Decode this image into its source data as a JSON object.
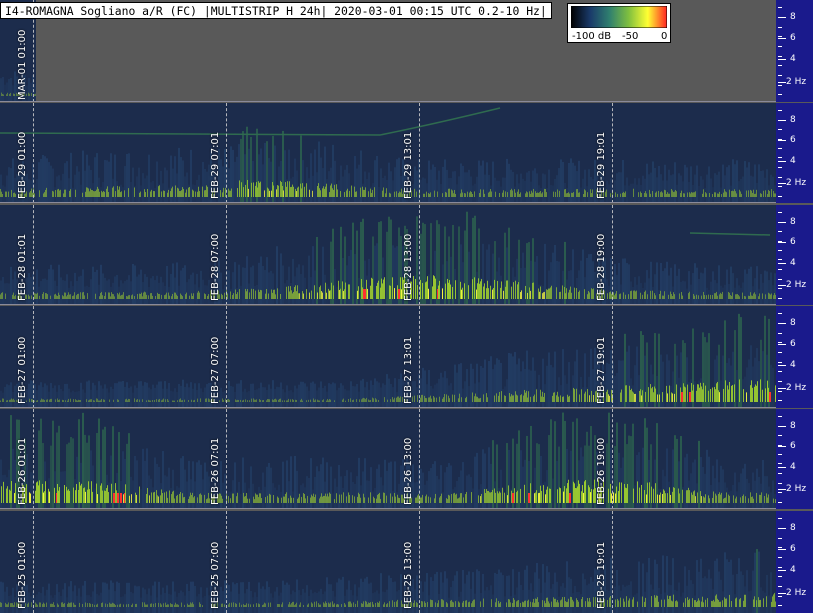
{
  "title": "I4-ROMAGNA Sogliano a/R (FC) |MULTISTRIP H 24h| 2020-03-01 00:15 UTC 0.2-10 Hz|",
  "legend": {
    "labels": [
      "-100 dB",
      "-50",
      "0"
    ],
    "colors": [
      "#000000",
      "#1a3a6a",
      "#2f7f6f",
      "#7fbf3f",
      "#ffff33",
      "#ff2222"
    ]
  },
  "colors": {
    "axis_bg": "#1a1a8c",
    "background": "#595959",
    "panel_bg": "#1c2c4c",
    "signal_low": "#2f6b4f",
    "signal_mid": "#9fcf2f",
    "signal_high": "#ffff40",
    "signal_peak": "#ff3030"
  },
  "axis": {
    "tick_labels": [
      "8",
      "6",
      "4",
      "2 Hz"
    ]
  },
  "strips": [
    {
      "id": "mar-01",
      "time_labels": [
        "MAR-01 01:00"
      ],
      "partial": true
    },
    {
      "id": "feb-29",
      "time_labels": [
        "FEB-29 01:00",
        "FEB-29 07:01",
        "FEB-29 13:01",
        "FEB-29 19:01"
      ]
    },
    {
      "id": "feb-28",
      "time_labels": [
        "FEB-28 01:01",
        "FEB-28 07:00",
        "FEB-28 13:00",
        "FEB-28 19:00"
      ]
    },
    {
      "id": "feb-27",
      "time_labels": [
        "FEB-27 01:00",
        "FEB-27 07:00",
        "FEB-27 13:01",
        "FEB-27 19:01"
      ]
    },
    {
      "id": "feb-26",
      "time_labels": [
        "FEB-26 01:01",
        "FEB-26 07:01",
        "FEB-26 13:00",
        "FEB-26 19:00"
      ]
    },
    {
      "id": "feb-25",
      "time_labels": [
        "FEB-25 01:00",
        "FEB-25 07:00",
        "FEB-25 13:00",
        "FEB-25 19:01"
      ]
    }
  ]
}
